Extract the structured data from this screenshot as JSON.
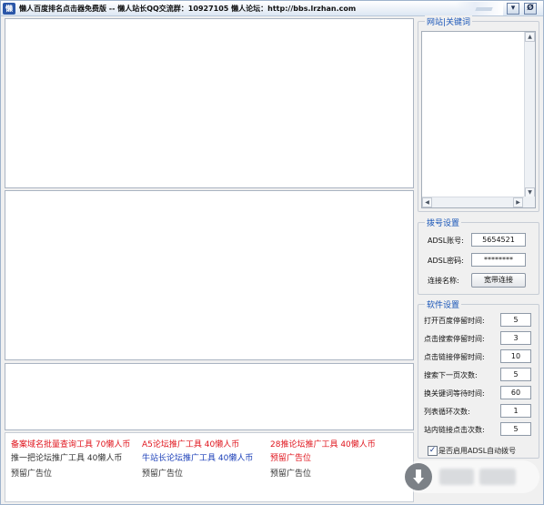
{
  "window": {
    "title": "懒人百度排名点击器免费版 -- 懒人站长QQ交流群：10927105 懒人论坛：http://bbs.lrzhan.com",
    "icon_char": "懒",
    "min_label": "▾",
    "close_label": "Ø"
  },
  "keywords": {
    "group_title": "网站|关键词",
    "scroll_up": "▲",
    "scroll_down": "▼",
    "scroll_left": "◀",
    "scroll_right": "▶"
  },
  "dial": {
    "group_title": "拨号设置",
    "account_label": "ADSL账号:",
    "account_value": "5654521",
    "password_label": "ADSL密码:",
    "password_value": "********",
    "conn_label": "连接名称:",
    "conn_value": "宽带连接"
  },
  "software": {
    "group_title": "软件设置",
    "rows": [
      {
        "label": "打开百度停留时间:",
        "value": "5"
      },
      {
        "label": "点击搜索停留时间:",
        "value": "3"
      },
      {
        "label": "点击链接停留时间:",
        "value": "10"
      },
      {
        "label": "搜索下一页次数:",
        "value": "5"
      },
      {
        "label": "换关键词等待时间:",
        "value": "60"
      },
      {
        "label": "列表循环次数:",
        "value": "1"
      },
      {
        "label": "站内链接点击次数:",
        "value": "5"
      }
    ],
    "adsl_auto_label": "是否启用ADSL自动拨号",
    "adsl_auto_checked": "✓"
  },
  "ads": [
    {
      "text": "备案域名批量查询工具  70懒人币",
      "color": "red"
    },
    {
      "text": "A5论坛推广工具  40懒人币",
      "color": "red"
    },
    {
      "text": "28推论坛推广工具  40懒人币",
      "color": "red"
    },
    {
      "text": "推一把论坛推广工具  40懒人币",
      "color": "gray"
    },
    {
      "text": "牛站长论坛推广工具  40懒人币",
      "color": "blue"
    },
    {
      "text": "预留广告位",
      "color": "red"
    },
    {
      "text": "预留广告位",
      "color": "gray"
    },
    {
      "text": "预留广告位",
      "color": "gray"
    },
    {
      "text": "预留广告位",
      "color": "gray"
    }
  ]
}
